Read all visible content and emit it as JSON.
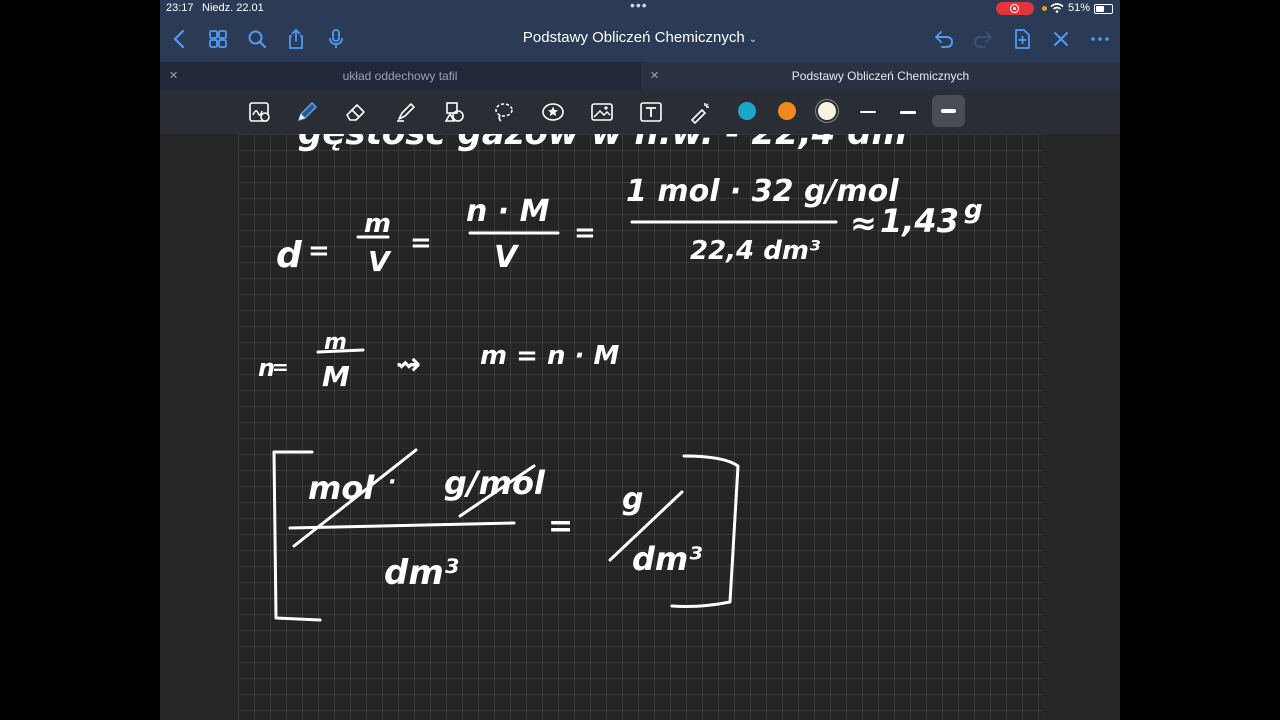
{
  "status_bar": {
    "time": "23:17",
    "date": "Niedz. 22.01",
    "battery_percent": "51%",
    "battery_level": 0.51,
    "recording": true
  },
  "nav": {
    "document_title": "Podstawy Obliczeń Chemicznych",
    "icons": [
      "chevron-left-icon",
      "grid-icon",
      "search-icon",
      "share-icon",
      "microphone-icon",
      "undo-icon",
      "redo-icon",
      "add-page-icon",
      "close-icon",
      "more-icon"
    ]
  },
  "tabs": [
    {
      "label": "układ oddechowy tafil",
      "active": false
    },
    {
      "label": "Podstawy Obliczeń Chemicznych",
      "active": true
    }
  ],
  "toolbar": {
    "tools": [
      "handwriting-zoom-icon",
      "pen-icon",
      "eraser-icon",
      "highlighter-icon",
      "shapes-icon",
      "lasso-icon",
      "sticker-icon",
      "image-icon",
      "text-icon",
      "laser-pointer-icon"
    ],
    "active_tool": "pen-icon",
    "colors": [
      "#1aa7c9",
      "#f18a1c",
      "#f8f3e0"
    ],
    "selected_color": "#f8f3e0",
    "stroke_widths": [
      "thin",
      "medium",
      "thick"
    ],
    "selected_stroke": "thick"
  },
  "note": {
    "header_partial": "gęstość gazów w n.w. - 22,4 dm",
    "eq1": {
      "lhs": "d",
      "f1_num": "m",
      "f1_den": "V",
      "f2_num": "n · M",
      "f2_den": "V",
      "f3_num": "1 mol · 32 g/mol",
      "f3_den": "22,4 dm³",
      "approx": "≈",
      "result": "1,43",
      "unit": "g"
    },
    "eq2": {
      "lhs": "n",
      "f_num": "m",
      "f_den": "M",
      "arrow": "⇝",
      "rhs": "m = n · M"
    },
    "eq3": {
      "num_left": "mol",
      "num_dot": "·",
      "num_right": "g/mol",
      "den": "dm³",
      "eq": "=",
      "res_num": "g",
      "res_den": "dm³"
    }
  }
}
